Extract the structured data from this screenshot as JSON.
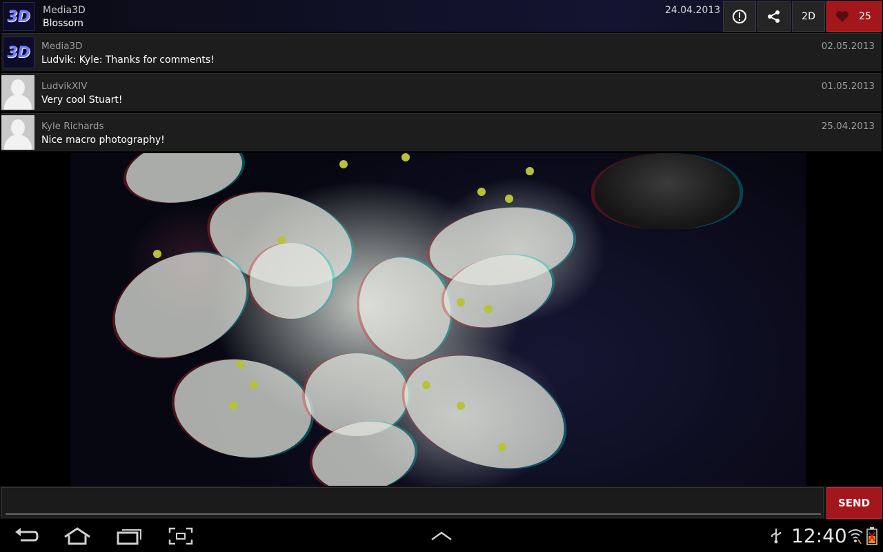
{
  "header": {
    "logo_text": "3D",
    "user": "Media3D",
    "title": "Blossom",
    "date": "24.04.2013",
    "buttons": {
      "report_icon": "alert-circle-icon",
      "share_icon": "share-icon",
      "mode_label": "2D",
      "like_count": "25"
    }
  },
  "comments": [
    {
      "user": "Media3D",
      "text": "Ludvik: Kyle: Thanks for comments!",
      "date": "02.05.2013",
      "avatar": "logo"
    },
    {
      "user": "LudvikXIV",
      "text": "Very cool Stuart!",
      "date": "01.05.2013",
      "avatar": "person"
    },
    {
      "user": "Kyle Richards",
      "text": "Nice macro photography!",
      "date": "25.04.2013",
      "avatar": "person"
    }
  ],
  "composer": {
    "value": "",
    "placeholder": "",
    "send_label": "SEND"
  },
  "system": {
    "clock": "12:40",
    "icons": [
      "back-icon",
      "home-icon",
      "recent-apps-icon",
      "screenshot-icon",
      "chevron-up-icon",
      "usb-icon",
      "wifi-icon",
      "battery-icon"
    ]
  },
  "colors": {
    "accent_red": "#a3171c",
    "panel": "#1d1d1d"
  }
}
